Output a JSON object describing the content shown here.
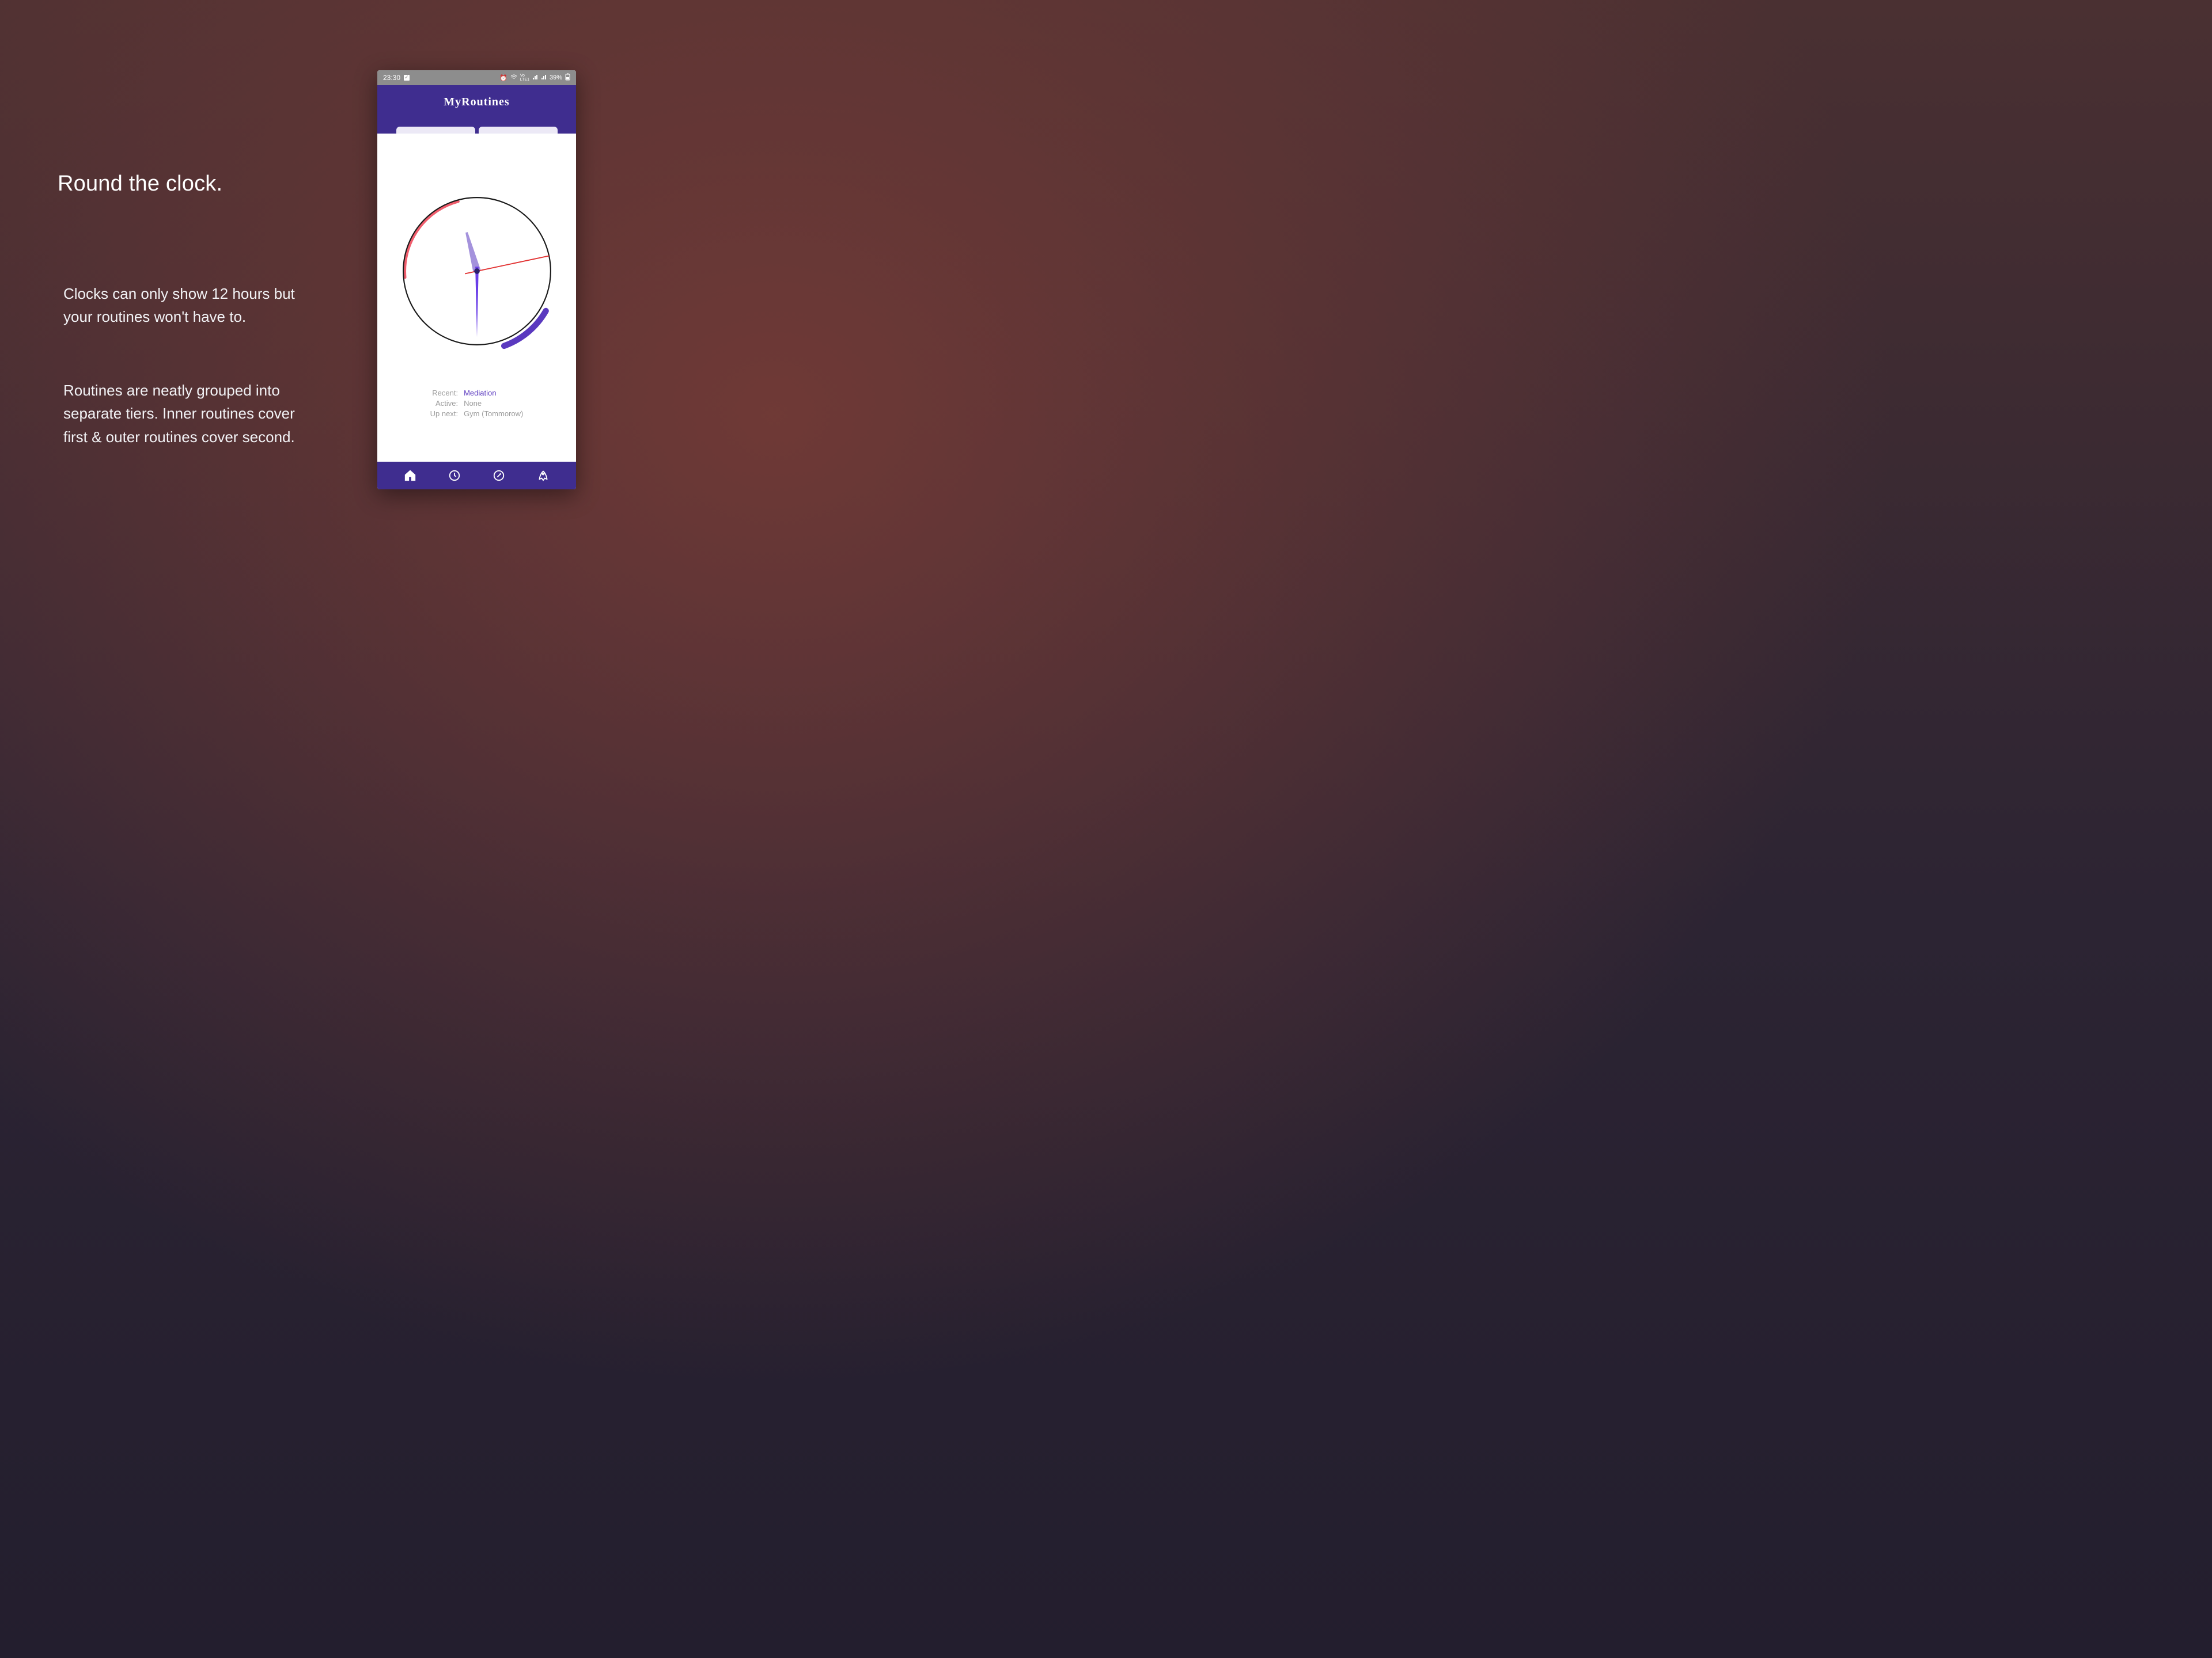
{
  "marketing": {
    "headline": "Round the clock.",
    "p1": "Clocks can only show 12 hours but your routines won't have to.",
    "p2": "Routines are neatly grouped into separate tiers. Inner routines cover first & outer routines cover second."
  },
  "statusbar": {
    "time": "23:30",
    "battery": "39%"
  },
  "app": {
    "title": "MyRoutines"
  },
  "routine_status": {
    "recent_label": "Recent:",
    "recent_value": "Mediation",
    "active_label": "Active:",
    "active_value": "None",
    "upnext_label": "Up next:",
    "upnext_value": "Gym (Tommorow)"
  },
  "clock": {
    "face_radius": 132,
    "hour_hand_angle_deg": 345,
    "minute_hand_angle_deg": 180,
    "second_hand_angle_deg": 78,
    "inner_arc_color": "#f05e6d",
    "inner_arc_start_deg": 275,
    "inner_arc_end_deg": 345,
    "outer_arc_color": "#5a39bf",
    "outer_arc_start_deg": 120,
    "outer_arc_end_deg": 160
  },
  "nav_icons": [
    "home",
    "clock",
    "edit",
    "rocket"
  ]
}
